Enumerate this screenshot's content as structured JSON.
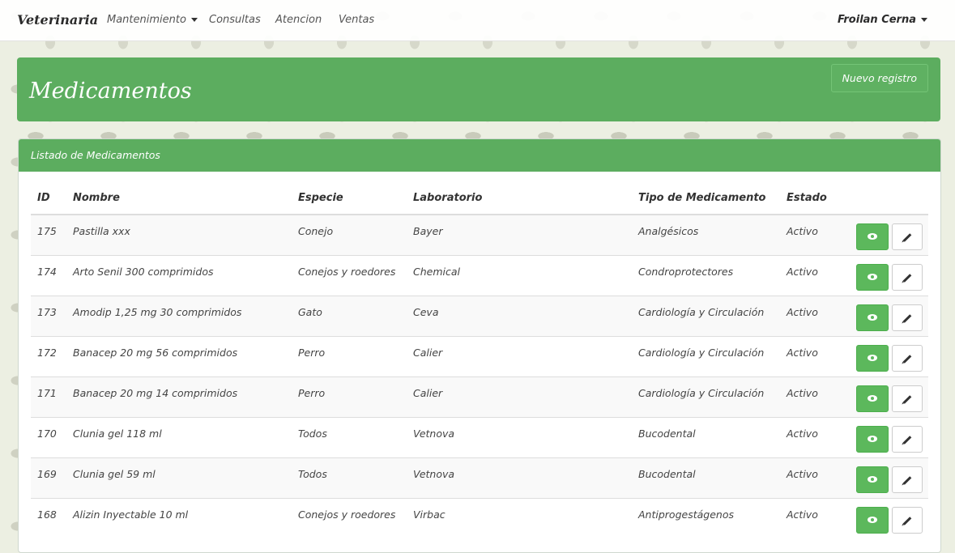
{
  "navbar": {
    "brand": "Veterinaria",
    "items": [
      {
        "label": "Mantenimiento",
        "dropdown": true
      },
      {
        "label": "Consultas"
      },
      {
        "label": "Atencion"
      },
      {
        "label": "Ventas"
      }
    ],
    "user": "Froilan Cerna"
  },
  "header": {
    "title": "Medicamentos",
    "new_button": "Nuevo registro"
  },
  "list": {
    "heading": "Listado de Medicamentos",
    "columns": [
      "ID",
      "Nombre",
      "Especie",
      "Laboratorio",
      "Tipo de Medicamento",
      "Estado"
    ],
    "rows": [
      {
        "id": "175",
        "nombre": "Pastilla xxx",
        "especie": "Conejo",
        "laboratorio": "Bayer",
        "tipo": "Analgésicos",
        "estado": "Activo"
      },
      {
        "id": "174",
        "nombre": "Arto Senil 300 comprimidos",
        "especie": "Conejos y roedores",
        "laboratorio": "Chemical",
        "tipo": "Condroprotectores",
        "estado": "Activo"
      },
      {
        "id": "173",
        "nombre": "Amodip 1,25 mg 30 comprimidos",
        "especie": "Gato",
        "laboratorio": "Ceva",
        "tipo": "Cardiología y Circulación",
        "estado": "Activo"
      },
      {
        "id": "172",
        "nombre": "Banacep 20 mg 56 comprimidos",
        "especie": "Perro",
        "laboratorio": "Calier",
        "tipo": "Cardiología y Circulación",
        "estado": "Activo"
      },
      {
        "id": "171",
        "nombre": "Banacep 20 mg 14 comprimidos",
        "especie": "Perro",
        "laboratorio": "Calier",
        "tipo": "Cardiología y Circulación",
        "estado": "Activo"
      },
      {
        "id": "170",
        "nombre": "Clunia gel 118 ml",
        "especie": "Todos",
        "laboratorio": "Vetnova",
        "tipo": "Bucodental",
        "estado": "Activo"
      },
      {
        "id": "169",
        "nombre": "Clunia gel 59 ml",
        "especie": "Todos",
        "laboratorio": "Vetnova",
        "tipo": "Bucodental",
        "estado": "Activo"
      },
      {
        "id": "168",
        "nombre": "Alizin Inyectable 10 ml",
        "especie": "Conejos y roedores",
        "laboratorio": "Virbac",
        "tipo": "Antiprogestágenos",
        "estado": "Activo"
      }
    ]
  },
  "icons": {
    "view": "eye-icon",
    "edit": "pencil-icon"
  },
  "colors": {
    "primary_green": "#5cad5f",
    "button_green": "#5cb85c"
  }
}
